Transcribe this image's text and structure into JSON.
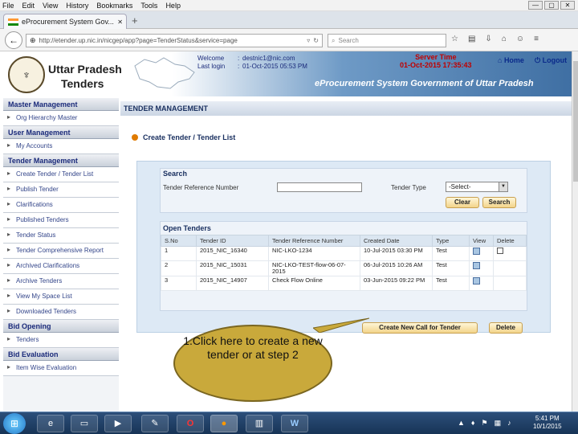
{
  "menu": [
    "File",
    "Edit",
    "View",
    "History",
    "Bookmarks",
    "Tools",
    "Help"
  ],
  "window_controls": {
    "min": "—",
    "max": "▢",
    "close": "✕"
  },
  "tab": {
    "title": "eProcurement System Gov...",
    "close": "✕",
    "new": "+"
  },
  "address": {
    "url": "http://etender.up.nic.in/nicgep/app?page=TenderStatus&service=page",
    "search_placeholder": "Search"
  },
  "header": {
    "brand_line1": "Uttar Pradesh",
    "brand_line2": "Tenders",
    "welcome_label": "Welcome",
    "welcome_sep": ":",
    "welcome_value": "destnic1@nic.com",
    "lastlogin_label": "Last login",
    "lastlogin_value": "01-Oct-2015 05:53 PM",
    "server_time_label": "Server Time",
    "server_time_value": "01-Oct-2015 17:35:43",
    "home": "Home",
    "logout": "Logout",
    "system_name": "eProcurement System Government of Uttar Pradesh"
  },
  "sidebar": {
    "sections": [
      {
        "title": "Master Management",
        "items": [
          "Org Hierarchy Master"
        ]
      },
      {
        "title": "User Management",
        "items": [
          "My Accounts"
        ]
      },
      {
        "title": "Tender Management",
        "items": [
          "Create Tender / Tender List",
          "Publish Tender",
          "Clarifications",
          "Published Tenders",
          "Tender Status",
          "Tender Comprehensive Report",
          "Archived Clarifications",
          "Archive Tenders",
          "View My Space List",
          "Downloaded Tenders"
        ]
      },
      {
        "title": "Bid Opening",
        "items": [
          "Tenders"
        ]
      },
      {
        "title": "Bid Evaluation",
        "items": [
          "Item Wise Evaluation"
        ]
      }
    ]
  },
  "main": {
    "section_title": "TENDER MANAGEMENT",
    "page_title": "Create Tender / Tender List",
    "search_title": "Search",
    "ref_label": "Tender Reference Number",
    "type_label": "Tender Type",
    "type_value": "-Select-",
    "clear": "Clear",
    "search": "Search",
    "open_title": "Open Tenders",
    "columns": [
      "S.No",
      "Tender ID",
      "Tender Reference Number",
      "Created Date",
      "Type",
      "View",
      "Delete"
    ],
    "rows": [
      {
        "sno": "1",
        "id": "2015_NIC_16340",
        "ref": "NIC-LKO-1234",
        "date": "10-Jul-2015 03:30 PM",
        "type": "Test"
      },
      {
        "sno": "2",
        "id": "2015_NIC_15031",
        "ref": "NIC-LKO-TEST-flow-06-07-2015",
        "date": "06-Jul-2015 10:26 AM",
        "type": "Test"
      },
      {
        "sno": "3",
        "id": "2015_NIC_14907",
        "ref": "Check Flow Online",
        "date": "03-Jun-2015 09:22 PM",
        "type": "Test"
      }
    ],
    "create_btn": "Create New Call for Tender",
    "delete_btn": "Delete"
  },
  "callout": "1.Click here to create a new tender or at step 2",
  "clock": {
    "time": "5:41 PM",
    "date": "10/1/2015"
  }
}
